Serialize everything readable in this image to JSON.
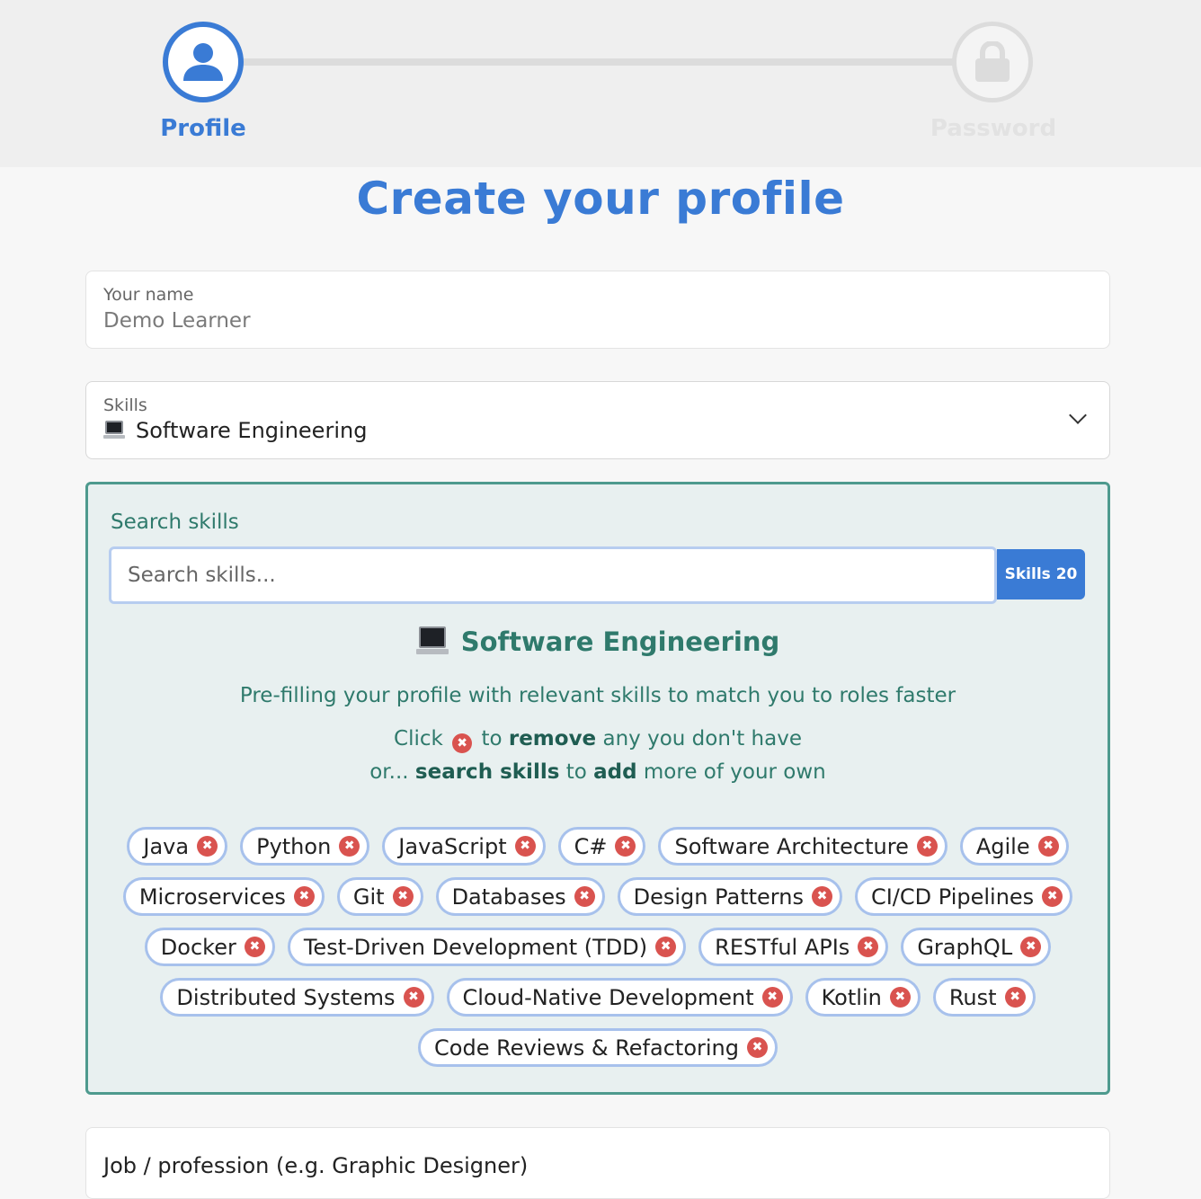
{
  "stepper": {
    "steps": [
      {
        "label": "Profile",
        "icon": "user-icon",
        "state": "active"
      },
      {
        "label": "Password",
        "icon": "lock-icon",
        "state": "inactive"
      }
    ]
  },
  "page": {
    "title": "Create your profile"
  },
  "name_field": {
    "label": "Your name",
    "value": "Demo Learner"
  },
  "skills_select": {
    "label": "Skills",
    "icon": "laptop-icon",
    "value": "Software Engineering"
  },
  "skills_panel": {
    "label": "Search skills",
    "search_placeholder": "Search skills...",
    "count_label": "Skills 20",
    "category_title": "Software Engineering",
    "info_line1": "Pre-filling your profile with relevant skills to match you to roles faster",
    "info_line2": {
      "a": "Click",
      "b": "to",
      "c": "remove",
      "d": "any you don't have"
    },
    "info_line3": {
      "a": "or...",
      "b": "search skills",
      "c": "to",
      "d": "add",
      "e": "more of your own"
    },
    "remove_glyph": "✖",
    "skills": [
      "Java",
      "Python",
      "JavaScript",
      "C#",
      "Software Architecture",
      "Agile",
      "Microservices",
      "Git",
      "Databases",
      "Design Patterns",
      "CI/CD Pipelines",
      "Docker",
      "Test-Driven Development (TDD)",
      "RESTful APIs",
      "GraphQL",
      "Distributed Systems",
      "Cloud-Native Development",
      "Kotlin",
      "Rust",
      "Code Reviews & Refactoring"
    ]
  },
  "job_field": {
    "label": "Job / profession (e.g. Graphic Designer)"
  },
  "colors": {
    "accent": "#3a7bd5",
    "panel_green": "#2f7a6c",
    "remove_red": "#d9534f"
  }
}
